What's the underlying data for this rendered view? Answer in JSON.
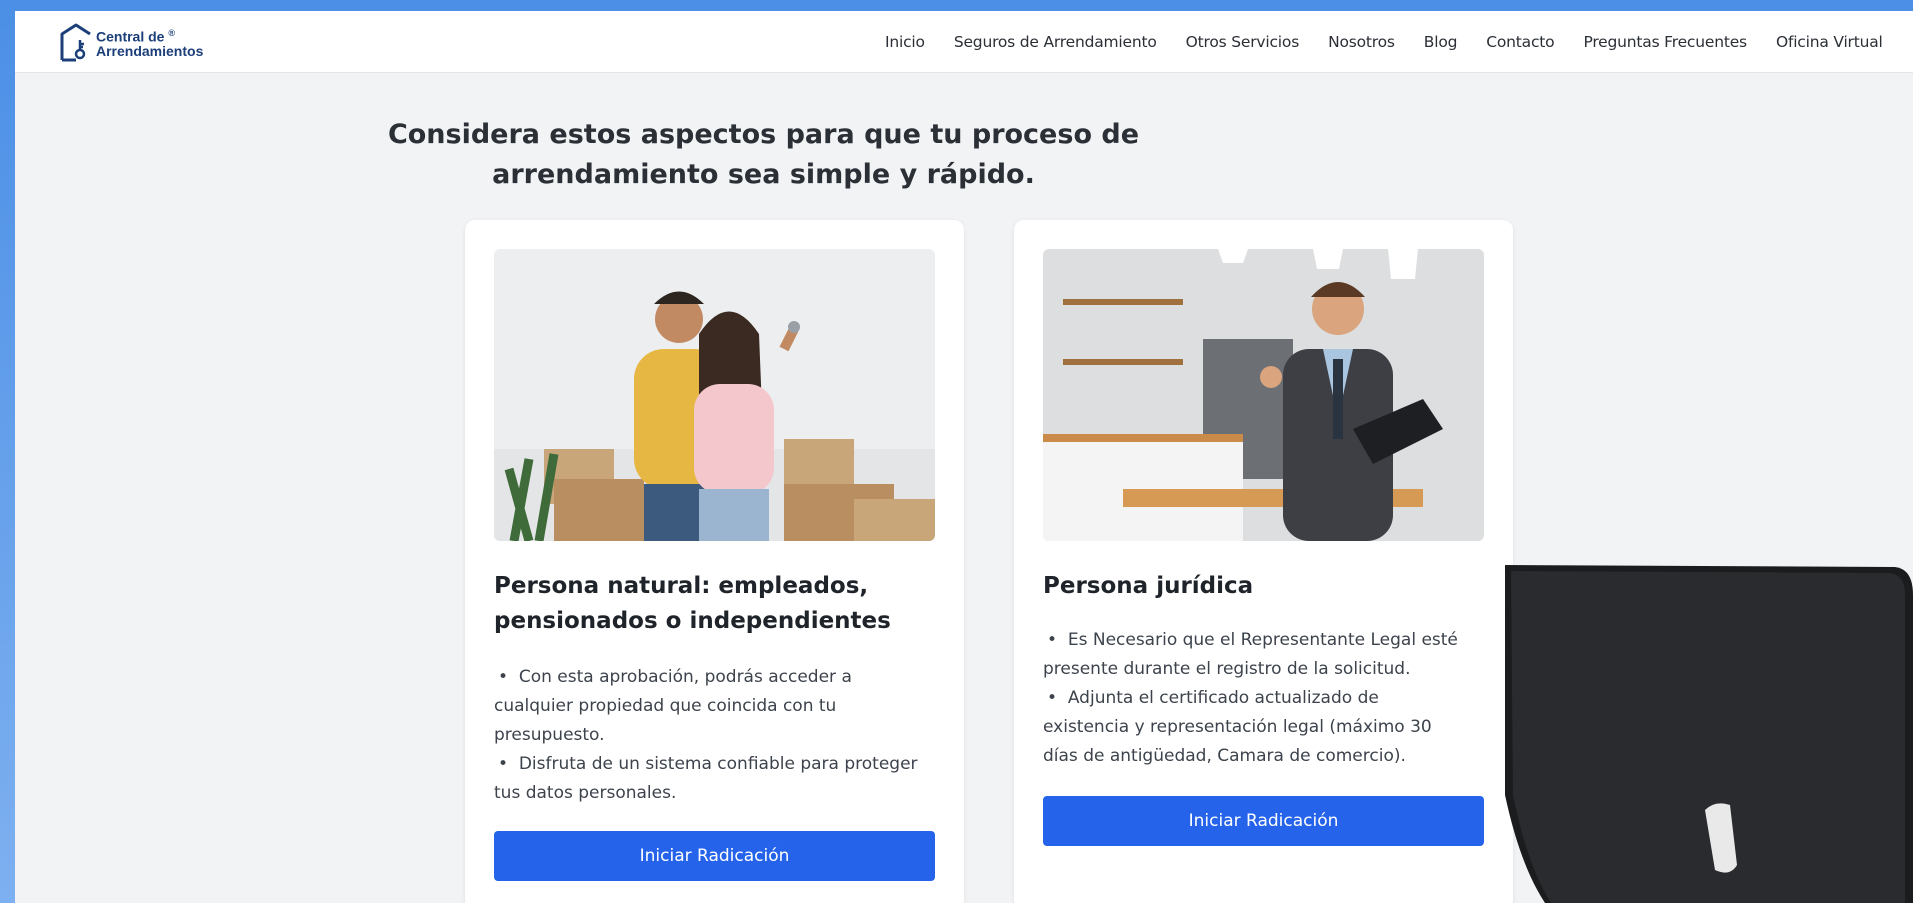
{
  "brand": {
    "line1": "Central de",
    "line2": "Arrendamientos",
    "registered_mark": "®",
    "color": "#1c3f7a"
  },
  "nav": {
    "items": [
      {
        "label": "Inicio"
      },
      {
        "label": "Seguros de Arrendamiento"
      },
      {
        "label": "Otros Servicios"
      },
      {
        "label": "Nosotros"
      },
      {
        "label": "Blog"
      },
      {
        "label": "Contacto"
      },
      {
        "label": "Preguntas Frecuentes"
      },
      {
        "label": "Oficina Virtual"
      }
    ]
  },
  "heading": {
    "line1": "Considera estos aspectos para que tu proceso de",
    "line2": "arrendamiento sea simple y rápido."
  },
  "cards": [
    {
      "photo_icon": "couple-with-keys-photo",
      "title_line1": "Persona natural: empleados,",
      "title_line2": "pensionados o independientes",
      "bullets": [
        "Con esta aprobación, podrás acceder a",
        "cualquier propiedad que coincida con tu",
        "presupuesto.",
        "Disfruta de un sistema confiable para proteger",
        "tus datos personales."
      ],
      "button_label": "Iniciar Radicación"
    },
    {
      "photo_icon": "businessman-with-keys-photo",
      "title_line1": "Persona jurídica",
      "bullets": [
        "Es Necesario que el Representante Legal esté",
        "presente durante el registro de la solicitud.",
        "Adjunta el certificado actualizado de",
        "existencia y representación legal (máximo 30",
        "días de antigüedad, Camara de comercio)."
      ],
      "button_label": "Iniciar Radicación"
    }
  ],
  "colors": {
    "accent": "#2563eb",
    "page_bg": "#f2f3f5",
    "outer_bg": "#4b8fe6"
  }
}
